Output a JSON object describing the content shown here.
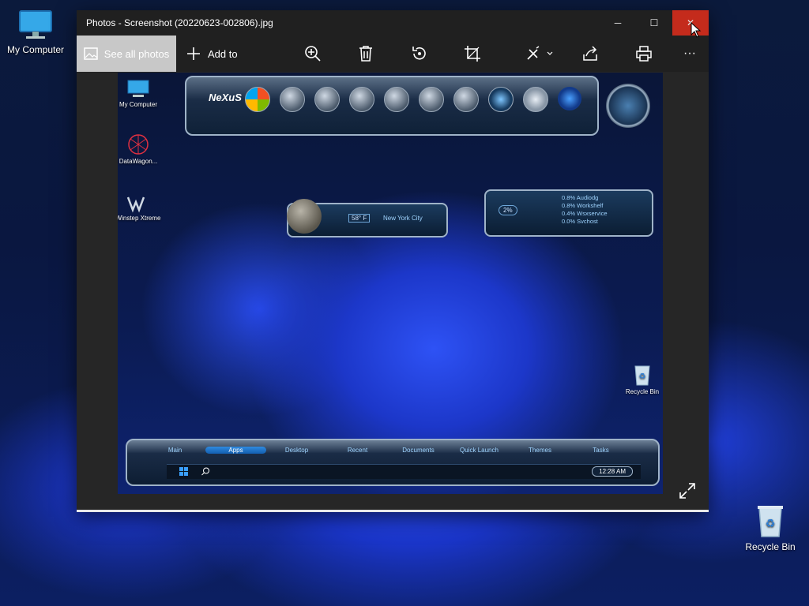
{
  "desktop": {
    "icons": [
      {
        "label": "My Computer",
        "name": "my-computer"
      },
      {
        "label": "Recycle Bin",
        "name": "recycle-bin"
      }
    ]
  },
  "window": {
    "title": "Photos - Screenshot (20220623-002806).jpg",
    "controls": {
      "minimize": "─",
      "maximize": "☐",
      "close": "✕"
    },
    "toolbar": {
      "see_all": "See all photos",
      "add_to": "Add to",
      "icons": [
        "zoom-in-icon",
        "delete-icon",
        "rotate-icon",
        "crop-icon",
        "edit-icon",
        "share-icon",
        "print-icon",
        "more-icon"
      ],
      "more": "···"
    }
  },
  "photo": {
    "desktop_icons": [
      {
        "label": "My Computer"
      },
      {
        "label": "DataWagon..."
      },
      {
        "label": "Winstep Xtreme"
      },
      {
        "label": "Recycle Bin"
      }
    ],
    "dock_logo": "NeXuS",
    "weather": {
      "temp": "58° F",
      "city": "New York City"
    },
    "sysmon": {
      "percent": "2%",
      "processes": [
        "0.8% Audiodg",
        "0.8% Workshelf",
        "0.4% Wsxservice",
        "0.0% Svchost"
      ]
    },
    "dock_tabs": [
      "Main",
      "Apps",
      "Desktop",
      "Recent",
      "Documents",
      "Quick Launch",
      "Themes",
      "Tasks"
    ],
    "active_tab": "Apps",
    "clock": "12:28 AM"
  },
  "colors": {
    "close": "#c42b1c",
    "titlebar": "#202020",
    "accent": "#2f8ae0"
  }
}
